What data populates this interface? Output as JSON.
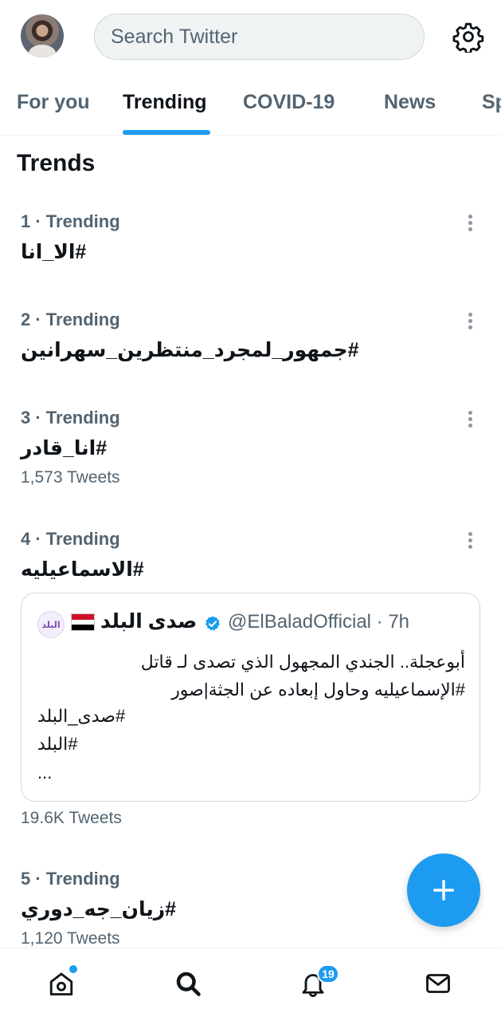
{
  "header": {
    "search_placeholder": "Search Twitter",
    "icons": [
      "avatar",
      "gear-icon"
    ]
  },
  "tabs": [
    {
      "label": "For you",
      "active": false
    },
    {
      "label": "Trending",
      "active": true
    },
    {
      "label": "COVID-19",
      "active": false
    },
    {
      "label": "News",
      "active": false
    },
    {
      "label": "Sp",
      "active": false
    }
  ],
  "section_title": "Trends",
  "trends": [
    {
      "meta": "1 · Trending",
      "name": "#الا_انا"
    },
    {
      "meta": "2 · Trending",
      "name": "#جمهور_لمجرد_منتظرين_سهرانين"
    },
    {
      "meta": "3 · Trending",
      "name": "#انا_قادر",
      "count": "1,573 Tweets"
    },
    {
      "meta": "4 · Trending",
      "name": "#الاسماعيليه",
      "count": "19.6K Tweets"
    },
    {
      "meta": "5 · Trending",
      "name": "#زيان_جه_دوري",
      "count": "1,120 Tweets"
    }
  ],
  "tweet": {
    "logo_text": "البلد",
    "author": "صدى البلد",
    "handle": "@ElBaladOfficial · 7h",
    "body_line1": "أبوعجلة.. الجندي المجهول الذي تصدى لـ قاتل",
    "body_line2": "#الإسماعيليه وحاول إبعاده عن الجثة|صور",
    "tag1": "صدى_البلد#",
    "tag2": "البلد#",
    "ellipsis": "..."
  },
  "bottom_nav": {
    "items": [
      "home-icon",
      "search-icon",
      "notifications-icon",
      "messages-icon"
    ],
    "notification_count": "19"
  },
  "colors": {
    "accent": "#1d9bf0",
    "text_primary": "#0f1419",
    "text_secondary": "#536471",
    "border": "#cfd9de"
  }
}
